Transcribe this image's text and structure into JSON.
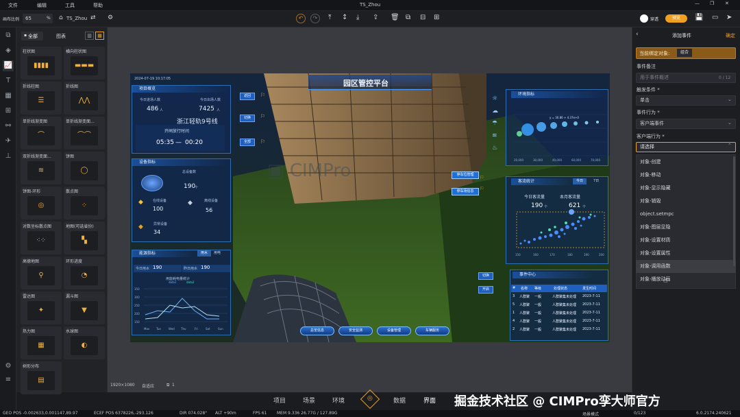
{
  "menu": {
    "file": "文件",
    "edit": "编辑",
    "tools": "工具",
    "help": "帮助",
    "title": "TS_Zhou"
  },
  "toolbar": {
    "zoom_label": "画布比例",
    "zoom_value": "65",
    "zoom_unit": "%",
    "project_name": "TS_Zhou",
    "theme_label": "穿透",
    "toggle_label": "预览"
  },
  "left_panel": {
    "tab_all": "全部",
    "tab_chart": "图表",
    "cards": [
      "柱状图",
      "横向柱状图",
      "折线柱图",
      "折线图",
      "单折线渐变图",
      "单折线渐变面...",
      "双折线渐变面...",
      "饼图",
      "饼图-环形",
      "散点图",
      "对数坐标散点图",
      "地图(可选省份)",
      "高德地图",
      "环形进度",
      "雷达图",
      "漏斗图",
      "热力图",
      "水球图",
      "树形分布"
    ]
  },
  "canvas_footer": {
    "size": "1920×1080",
    "mode": "自适应",
    "layers": "1"
  },
  "dashboard": {
    "title": "园区管控平台",
    "date": "2024-07-19 10:17:05",
    "project": {
      "header": "项目概览",
      "today_enter_label": "今日进场人数",
      "today_enter": "486",
      "today_exit_label": "今日出场人数",
      "today_exit": "7425",
      "unit": "人",
      "line": "浙江轻轨9号线",
      "open_label": "开闸放行时间",
      "time_from": "05:35",
      "time_to": "00:20"
    },
    "device": {
      "header": "设备指标",
      "total_label": "总设备数",
      "total": "190",
      "total_unit": "个",
      "online_label": "在线设备",
      "online": "100",
      "offline_label": "离线设备",
      "offline": "56",
      "fault_label": "异常设备",
      "fault": "34"
    },
    "energy": {
      "header": "能源指标",
      "tab_water": "用水",
      "tab_power": "用电",
      "today_label": "今日用水",
      "today": "190",
      "yday_label": "昨日用水",
      "yday": "190",
      "chart_title": "用能耗电量统计",
      "legend1": "data1",
      "legend2": "data2"
    },
    "env": {
      "header": "环境指标",
      "legend": "y = 30.86 + 4.37e+0"
    },
    "flow": {
      "header": "客流统计",
      "tab_today": "今日",
      "tab_7": "7日",
      "today_label": "今日客流量",
      "today": "190",
      "month_label": "本月客流量",
      "month": "621",
      "unit": "个"
    },
    "events": {
      "header": "事件中心",
      "cols": [
        "名称",
        "等级",
        "处理状态",
        "发生时间"
      ],
      "rows": [
        [
          "3",
          "人群聚",
          "一般",
          "人群聚集未处理",
          "2023-7-11"
        ],
        [
          "5",
          "人群聚",
          "一般",
          "人群聚集未处理",
          "2023-7-11"
        ],
        [
          "1",
          "人群聚",
          "一般",
          "人群聚集未处理",
          "2023-7-11"
        ],
        [
          "4",
          "人群聚",
          "一般",
          "人群聚集未处理",
          "2023-7-11"
        ],
        [
          "2",
          "人群聚",
          "一般",
          "人群聚集未处理",
          "2023-7-11"
        ]
      ]
    },
    "buttons": [
      "总览信息",
      "安全监测",
      "设备管理",
      "车辆服务"
    ],
    "side_buttons": [
      "返回",
      "切换",
      "全部"
    ],
    "popup": [
      "停车位管理",
      "停车场信息"
    ],
    "map_tags": [
      "切换",
      "开启"
    ]
  },
  "right_panel": {
    "title": "添加事件",
    "confirm": "确定",
    "bound_label": "当前绑定对象:",
    "bound_value": "组合",
    "note_label": "事件备注",
    "note_placeholder": "用于事件概述",
    "note_count": "0 / 12",
    "trigger_label": "触发条件 *",
    "trigger_value": "单击",
    "behavior_label": "事件行为 *",
    "behavior_value": "客户端事件",
    "client_label": "客户端行为 *",
    "client_placeholder": "请选择",
    "options": [
      "对象-创建",
      "对象-移动",
      "对象-显示隐藏",
      "对象-销毁",
      "object.setmpc",
      "对象-图层显隐",
      "对象-设置材质",
      "对象-设置属性",
      "对象-调用函数",
      "对象-播放动画"
    ]
  },
  "bottom_nav": [
    "项目",
    "场景",
    "环境",
    "数据",
    "界面"
  ],
  "status": {
    "geo": "GEO POS -0.002633,0.001147,89.97",
    "ecef": "ECEF POS 6378226,-293.126",
    "dir": "DIR 074.028°",
    "alt": "ALT +90m",
    "fps": "FPS 61",
    "mem": "MEM 9.336 26.77G / 127.89G",
    "scene": "场景模式",
    "sync": "0/123",
    "version": "6.0.2174.240621"
  },
  "watermark": "掘金技术社区 @ CIMPro孪大师官方",
  "colors": {
    "accent": "#f0a020",
    "selected": "#c07a20",
    "hud_blue": "#2c6fb5"
  }
}
